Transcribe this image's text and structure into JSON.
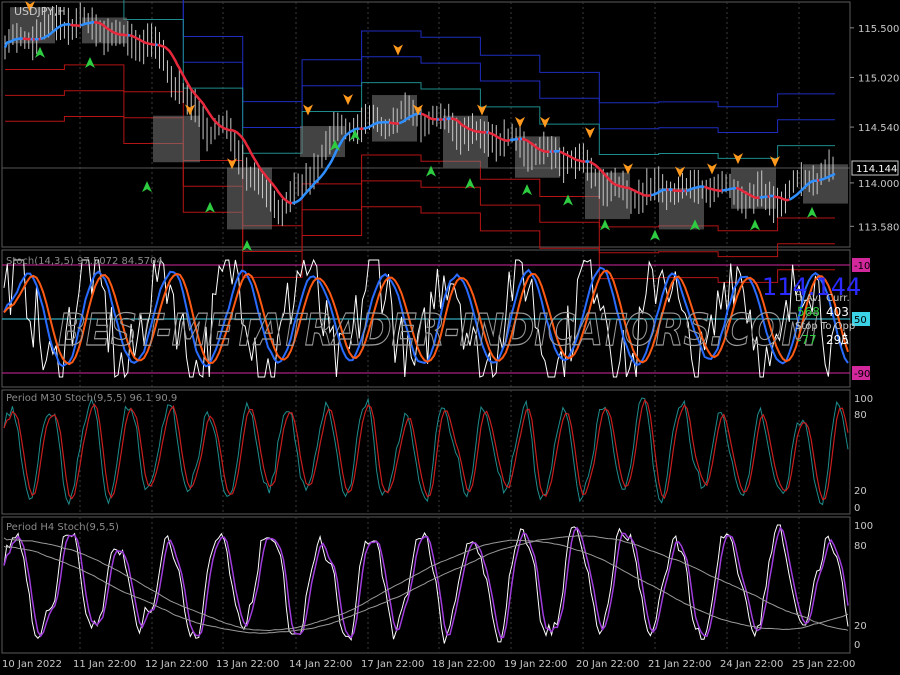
{
  "window": {
    "symbol_label": "USDJPY,H"
  },
  "colors": {
    "background": "#000000",
    "grid": "#3c3c3c",
    "axis_text": "#c8c8c8",
    "price_line": "#c8c8c8",
    "ma_up": "#2f8fff",
    "ma_down": "#e8283c",
    "band_blue": "#1e2dbe",
    "band_red": "#b41414",
    "band_teal": "#1e8c8c",
    "signal_up": "#2ecc40",
    "signal_down": "#ff9a1e",
    "stoch_main": "#ffffff",
    "stoch_blue": "#2a6cff",
    "stoch_orange": "#ff5a14",
    "level_magenta": "#d2289b",
    "level_cyan": "#3cd2e6",
    "m30_red": "#c81e1e",
    "m30_teal": "#1e8c8c",
    "h4_purple": "#a03cdc",
    "h4_white": "#ffffff",
    "h4_grey": "#9a9a9a",
    "watermark": "#9a9a9a",
    "info_bigvalue": "#2a2aff"
  },
  "price_axis": {
    "ticks": [
      "115.500",
      "115.020",
      "114.540",
      "114.000",
      "113.580"
    ],
    "current": "114.144"
  },
  "time_axis": {
    "labels": [
      "10 Jan 2022",
      "11 Jan 22:00",
      "12 Jan 22:00",
      "13 Jan 22:00",
      "14 Jan 22:00",
      "17 Jan 22:00",
      "18 Jan 22:00",
      "19 Jan 22:00",
      "20 Jan 22:00",
      "21 Jan 22:00",
      "24 Jan 22:00",
      "25 Jan 22:00"
    ]
  },
  "panel_stoch": {
    "title": "Stoch(14,3,5) 97.5072 84.5704",
    "levels": [
      "-10",
      "50",
      "-90"
    ],
    "info": {
      "big_value": "114.144",
      "col1_header": "D.Av.",
      "col2_header": "Curr.",
      "val1": "568",
      "val2": "403",
      "row2_label": "Stop To Opp",
      "val3": "-77",
      "val4": "295"
    }
  },
  "panel_m30": {
    "title": "Period M30 Stoch(9,5,5) 96.1 90.9",
    "ticks": [
      "100",
      "80",
      "20",
      "0"
    ]
  },
  "panel_h4": {
    "title": "Period H4 Stoch(9,5,5)",
    "ticks": [
      "100",
      "80",
      "20",
      "0"
    ]
  },
  "watermark": "BEST-METATRADER-INDICATORS.COM",
  "chart_data": [
    {
      "type": "line",
      "name": "price",
      "ylim": [
        113.38,
        115.75
      ],
      "yticks": [
        115.5,
        115.02,
        114.54,
        114.0,
        113.58
      ],
      "x": [
        "10 Jan 2022",
        "11 Jan 22:00",
        "12 Jan 22:00",
        "13 Jan 22:00",
        "14 Jan 22:00",
        "17 Jan 22:00",
        "18 Jan 22:00",
        "19 Jan 22:00",
        "20 Jan 22:00",
        "21 Jan 22:00",
        "24 Jan 22:00",
        "25 Jan 22:00"
      ],
      "series": [
        {
          "values": [
            115.35,
            115.55,
            115.35,
            114.55,
            113.8,
            114.55,
            114.65,
            114.45,
            114.25,
            113.9,
            113.95,
            113.85,
            114.12
          ]
        }
      ],
      "current_price": 114.144
    },
    {
      "type": "line",
      "ylim": [
        0,
        100
      ],
      "levels": [
        -10,
        50,
        -90
      ],
      "last_values": [
        97.5072,
        84.5704
      ]
    },
    {
      "type": "line",
      "ylim": [
        0,
        100
      ],
      "levels": [
        100,
        80,
        20,
        0
      ],
      "last_values": [
        96.1,
        90.9
      ]
    },
    {
      "type": "line",
      "ylim": [
        0,
        100
      ],
      "levels": [
        100,
        80,
        20,
        0
      ]
    }
  ]
}
